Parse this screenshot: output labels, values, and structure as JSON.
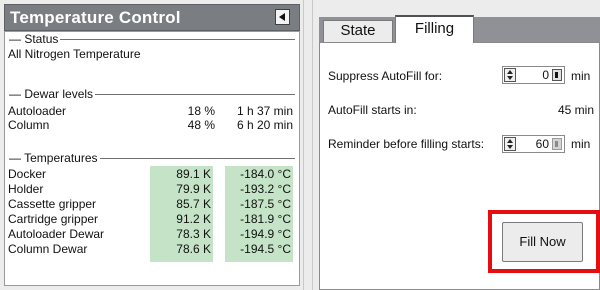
{
  "left_panel": {
    "title": "Temperature Control",
    "collapse_icon": "triangle-left-icon",
    "status": {
      "label": "Status",
      "value": "All Nitrogen Temperature"
    },
    "dewar_levels": {
      "label": "Dewar levels",
      "rows": [
        {
          "name": "Autoloader",
          "percent": "18 %",
          "time": "1 h 37 min"
        },
        {
          "name": "Column",
          "percent": "48 %",
          "time": "6 h 20 min"
        }
      ]
    },
    "temperatures": {
      "label": "Temperatures",
      "rows": [
        {
          "name": "Docker",
          "kelvin": "89.1 K",
          "celsius": "-184.0 °C"
        },
        {
          "name": "Holder",
          "kelvin": "79.9 K",
          "celsius": "-193.2 °C"
        },
        {
          "name": "Cassette gripper",
          "kelvin": "85.7 K",
          "celsius": "-187.5 °C"
        },
        {
          "name": "Cartridge gripper",
          "kelvin": "91.2 K",
          "celsius": "-181.9 °C"
        },
        {
          "name": "Autoloader Dewar",
          "kelvin": "78.3 K",
          "celsius": "-194.9 °C"
        },
        {
          "name": "Column Dewar",
          "kelvin": "78.6 K",
          "celsius": "-194.5 °C"
        }
      ],
      "highlight_color": "#c5e3c7"
    }
  },
  "right_panel": {
    "tabs": [
      {
        "label": "State",
        "active": false
      },
      {
        "label": "Filling",
        "active": true
      }
    ],
    "filling": {
      "suppress_label": "Suppress AutoFill for:",
      "suppress_value": "0",
      "suppress_unit": "min",
      "autofill_label": "AutoFill starts in:",
      "autofill_value": "45 min",
      "reminder_label": "Reminder before filling starts:",
      "reminder_value": "60",
      "reminder_unit": "min",
      "fill_now_label": "Fill Now",
      "highlight_color": "#e50d0d"
    }
  }
}
